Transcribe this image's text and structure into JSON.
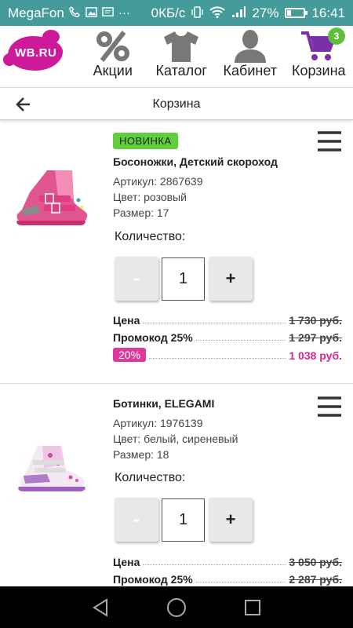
{
  "status_bar": {
    "carrier": "MegaFon",
    "speed": "0КБ/с",
    "battery": "27%",
    "battery_level": 0.27,
    "time": "16:41",
    "icons": [
      "phone-icon",
      "image-icon",
      "message-icon",
      "more-icon",
      "vibrate-icon",
      "wifi-icon",
      "signal-icon",
      "battery-icon"
    ]
  },
  "header": {
    "logo": "WB.RU",
    "nav": [
      {
        "label": "Акции",
        "icon": "percent-icon"
      },
      {
        "label": "Каталог",
        "icon": "shirt-icon"
      },
      {
        "label": "Кабинет",
        "icon": "user-icon"
      },
      {
        "label": "Корзина",
        "icon": "cart-icon",
        "badge": "3"
      }
    ]
  },
  "page": {
    "title": "Корзина"
  },
  "items": [
    {
      "new_badge": "НОВИНКА",
      "name": "Босоножки, Детский скороход",
      "article": "Артикул: 2867639",
      "color": "Цвет: розовый",
      "size": "Размер: 17",
      "qty_label": "Количество:",
      "minus": "-",
      "quantity": "1",
      "plus": "+",
      "price_label": "Цена",
      "price": "1 730 руб.",
      "promo_label": "Промокод 25%",
      "promo_price": "1 297 руб.",
      "discount": "20%",
      "final_price": "1 038 руб."
    },
    {
      "name": "Ботинки, ELEGAMI",
      "article": "Артикул: 1976139",
      "color": "Цвет: белый, сиреневый",
      "size": "Размер: 18",
      "qty_label": "Количество:",
      "minus": "-",
      "quantity": "1",
      "plus": "+",
      "price_label": "Цена",
      "price": "3 050 руб.",
      "promo_label": "Промокод 25%",
      "promo_price": "2 287 руб."
    }
  ],
  "colors": {
    "status_bar": "#449b99",
    "brand": "#cc1a9b",
    "cart_icon": "#7b2fa8",
    "badge": "#5fbf3c",
    "new_badge": "#5fd03c",
    "final_price": "#d42a8f"
  }
}
